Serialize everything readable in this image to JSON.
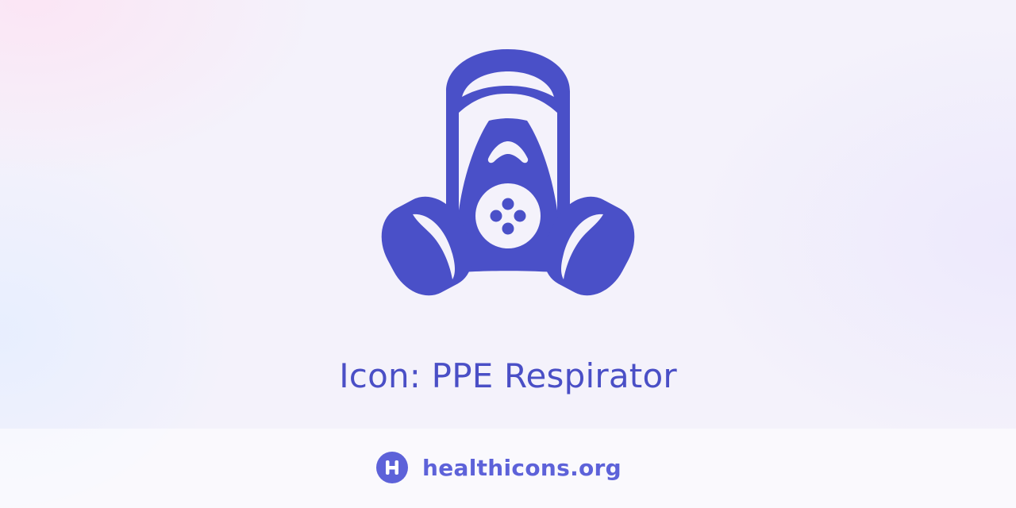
{
  "icon": {
    "name": "ppe-respirator-icon",
    "color": "#4a50c8"
  },
  "title": "Icon: PPE Respirator",
  "footer": {
    "logo_icon": "healthicons-logo-icon",
    "site_label": "healthicons.org",
    "brand_color": "#5d62d9"
  }
}
